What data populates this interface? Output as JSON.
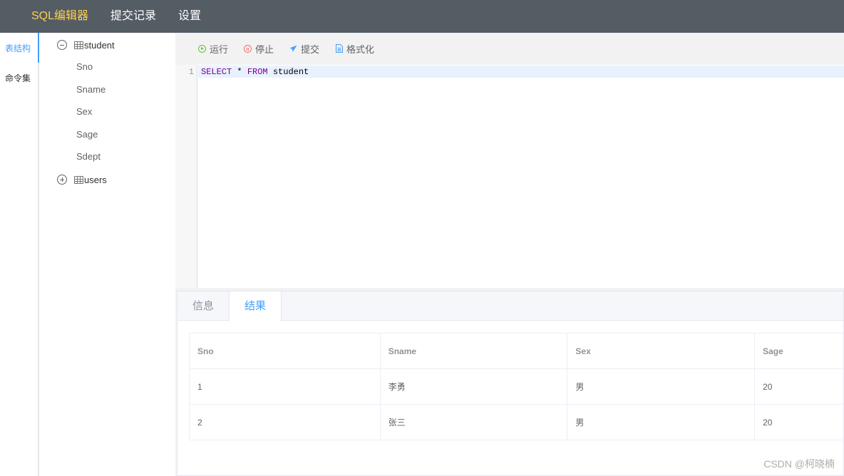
{
  "topbar": {
    "items": [
      {
        "label": "SQL编辑器",
        "active": true
      },
      {
        "label": "提交记录",
        "active": false
      },
      {
        "label": "设置",
        "active": false
      }
    ],
    "active_color": "#ffd04b",
    "bg_color": "#545c64"
  },
  "side_tabs": [
    {
      "label": "表结构",
      "active": true
    },
    {
      "label": "命令集",
      "active": false
    }
  ],
  "tree": {
    "tables": [
      {
        "name": "student",
        "expanded": true,
        "toggle_icon": "minus-circle-icon",
        "columns": [
          "Sno",
          "Sname",
          "Sex",
          "Sage",
          "Sdept"
        ]
      },
      {
        "name": "users",
        "expanded": false,
        "toggle_icon": "plus-circle-icon",
        "columns": []
      }
    ]
  },
  "toolbar": {
    "run": {
      "label": "运行",
      "icon": "play-circle-icon",
      "color": "#67c23a"
    },
    "stop": {
      "label": "停止",
      "icon": "pause-circle-icon",
      "color": "#f56c6c"
    },
    "submit": {
      "label": "提交",
      "icon": "send-icon",
      "color": "#409eff"
    },
    "format": {
      "label": "格式化",
      "icon": "document-icon",
      "color": "#409eff"
    }
  },
  "editor": {
    "lines": [
      {
        "number": "1",
        "tokens": [
          {
            "text": "SELECT",
            "kw": true
          },
          {
            "text": " * ",
            "kw": false
          },
          {
            "text": "FROM",
            "kw": true
          },
          {
            "text": " student",
            "kw": false
          }
        ]
      }
    ]
  },
  "result": {
    "tabs": [
      {
        "label": "信息",
        "active": false
      },
      {
        "label": "结果",
        "active": true
      }
    ],
    "columns": [
      "Sno",
      "Sname",
      "Sex",
      "Sage"
    ],
    "rows": [
      [
        "1",
        "李勇",
        "男",
        "20"
      ],
      [
        "2",
        "张三",
        "男",
        "20"
      ]
    ]
  },
  "watermark": "CSDN @柯晓楠"
}
